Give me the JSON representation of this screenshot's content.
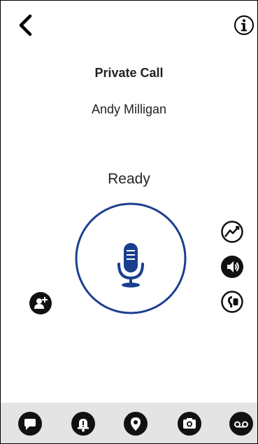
{
  "call": {
    "type_label": "Private Call",
    "contact_name": "Andy Milligan",
    "status": "Ready"
  },
  "colors": {
    "accent": "#1b3f8f",
    "icon_dark": "#111111",
    "bottom_bar": "#e4e4e4"
  },
  "icons": {
    "header": [
      "back-icon",
      "info-icon"
    ],
    "main": [
      "microphone-icon"
    ],
    "side": [
      "add-user-icon",
      "network-signal-icon",
      "speaker-icon",
      "earpiece-icon"
    ],
    "bottom_tabs": [
      "message-icon",
      "alert-bell-icon",
      "location-pin-icon",
      "camera-icon",
      "voicemail-icon"
    ]
  }
}
